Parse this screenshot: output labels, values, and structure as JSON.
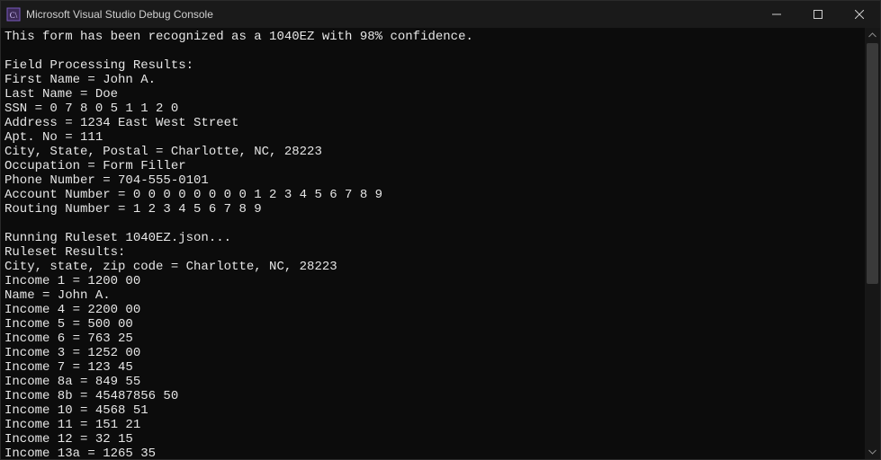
{
  "window": {
    "title": "Microsoft Visual Studio Debug Console"
  },
  "console": {
    "lines": [
      "This form has been recognized as a 1040EZ with 98% confidence.",
      "",
      "Field Processing Results:",
      "First Name = John A.",
      "Last Name = Doe",
      "SSN = 0 7 8 0 5 1 1 2 0",
      "Address = 1234 East West Street",
      "Apt. No = 111",
      "City, State, Postal = Charlotte, NC, 28223",
      "Occupation = Form Filler",
      "Phone Number = 704-555-0101",
      "Account Number = 0 0 0 0 0 0 0 0 1 2 3 4 5 6 7 8 9",
      "Routing Number = 1 2 3 4 5 6 7 8 9",
      "",
      "Running Ruleset 1040EZ.json...",
      "Ruleset Results:",
      "City, state, zip code = Charlotte, NC, 28223",
      "Income 1 = 1200 00",
      "Name = John A.",
      "Income 4 = 2200 00",
      "Income 5 = 500 00",
      "Income 6 = 763 25",
      "Income 3 = 1252 00",
      "Income 7 = 123 45",
      "Income 8a = 849 55",
      "Income 8b = 45487856 50",
      "Income 10 = 4568 51",
      "Income 11 = 151 21",
      "Income 12 = 32 15",
      "Income 13a = 1265 35"
    ]
  }
}
